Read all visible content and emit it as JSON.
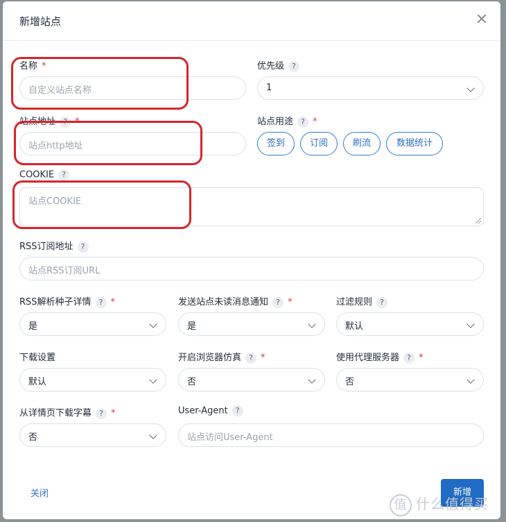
{
  "dialog": {
    "title": "新增站点",
    "close_icon": "✕"
  },
  "fields": {
    "name": {
      "label": "名称",
      "required": "*",
      "placeholder": "自定义站点名称"
    },
    "priority": {
      "label": "优先级",
      "help": "?",
      "value": "1"
    },
    "url": {
      "label": "站点地址",
      "help": "?",
      "required": "*",
      "placeholder": "站点http地址"
    },
    "usage": {
      "label": "站点用途",
      "help": "?",
      "required": "*",
      "chips": [
        "签到",
        "订阅",
        "刷流",
        "数据统计"
      ]
    },
    "cookie": {
      "label": "COOKIE",
      "help": "?",
      "placeholder": "站点COOKIE"
    },
    "rss": {
      "label": "RSS订阅地址",
      "help": "?",
      "placeholder": "站点RSS订阅URL"
    },
    "rss_parse": {
      "label": "RSS解析种子详情",
      "help": "?",
      "required": "*",
      "value": "是"
    },
    "notify": {
      "label": "发送站点未读消息通知",
      "help": "?",
      "required": "*",
      "value": "是"
    },
    "filter": {
      "label": "过滤规则",
      "help": "?",
      "value": "默认"
    },
    "download": {
      "label": "下载设置",
      "value": "默认"
    },
    "browser": {
      "label": "开启浏览器仿真",
      "help": "?",
      "required": "*",
      "value": "否"
    },
    "proxy": {
      "label": "使用代理服务器",
      "help": "?",
      "required": "*",
      "value": "否"
    },
    "subtitle": {
      "label": "从详情页下载字幕",
      "help": "?",
      "required": "*",
      "value": "否"
    },
    "ua": {
      "label": "User-Agent",
      "help": "?",
      "placeholder": "站点访问User-Agent"
    }
  },
  "footer": {
    "close_label": "关闭",
    "submit_label": "新增"
  },
  "watermark": {
    "logo": "值",
    "text": "什么值得买"
  },
  "colors": {
    "primary": "#206bc4",
    "annotation": "#d8232a",
    "required": "#d63939"
  }
}
